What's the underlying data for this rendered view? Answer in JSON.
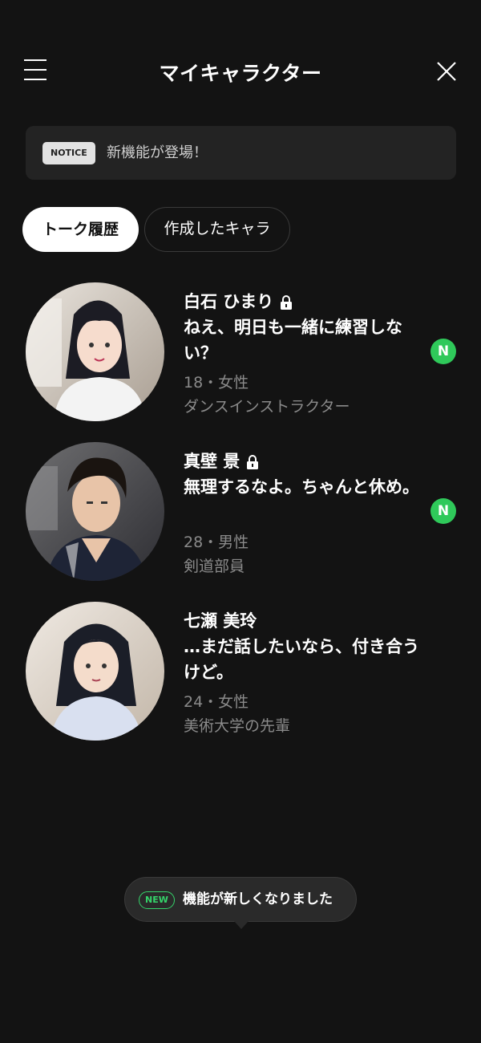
{
  "header": {
    "title": "マイキャラクター",
    "menu_icon": "hamburger-menu-icon",
    "close_icon": "close-icon"
  },
  "notice": {
    "badge": "NOTICE",
    "text": "新機能が登場！"
  },
  "tabs": [
    {
      "label": "トーク履歴",
      "active": true
    },
    {
      "label": "作成したキャラ",
      "active": false
    }
  ],
  "chats": [
    {
      "name": "白石 ひまり",
      "locked": true,
      "message": "ねえ、明日も一緒に練習しない？",
      "meta": "18・女性",
      "role": "ダンスインストラクター",
      "new_badge": "N"
    },
    {
      "name": "真壁 景",
      "locked": true,
      "message": "無理するなよ。ちゃんと休め。",
      "meta": "28・男性",
      "role": "剣道部員",
      "new_badge": "N"
    },
    {
      "name": "七瀬 美玲",
      "locked": false,
      "message": "…まだ話したいなら、付き合うけど。",
      "meta": "24・女性",
      "role": "美術大学の先輩",
      "new_badge": ""
    }
  ],
  "toast": {
    "badge": "NEW",
    "text": "機能が新しくなりました"
  },
  "colors": {
    "background": "#131313",
    "new_dot": "#2fc95a",
    "toast_badge": "#35d46a"
  }
}
